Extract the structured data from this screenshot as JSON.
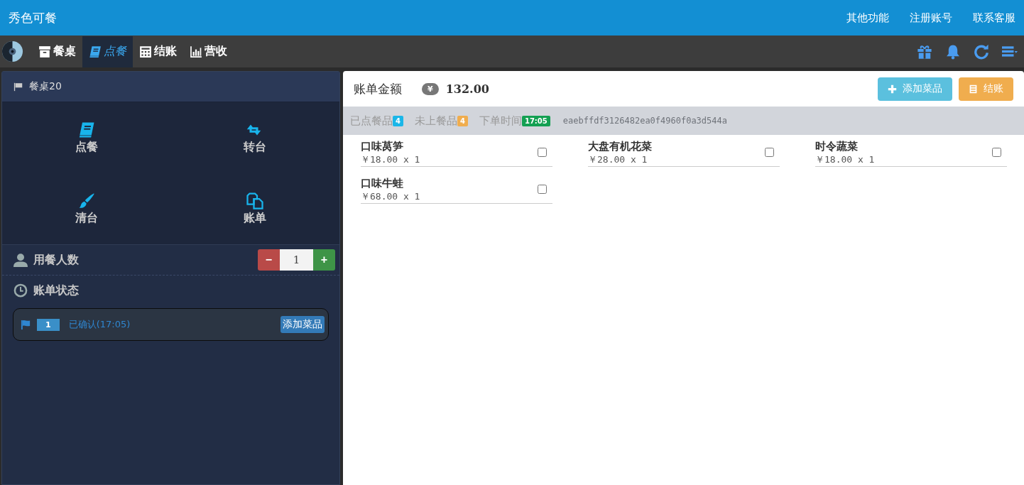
{
  "app_title": "秀色可餐",
  "top_links": [
    "其他功能",
    "注册账号",
    "联系客服"
  ],
  "nav_tabs": [
    {
      "label": "餐桌",
      "selected": false
    },
    {
      "label": "点餐",
      "selected": true
    },
    {
      "label": "结账",
      "selected": false
    },
    {
      "label": "营收",
      "selected": false
    }
  ],
  "table_panel": {
    "title": "餐桌20",
    "actions": [
      {
        "label": "点餐"
      },
      {
        "label": "转台"
      },
      {
        "label": "清台"
      },
      {
        "label": "账单"
      }
    ],
    "guests": {
      "label": "用餐人数",
      "value": "1",
      "minus": "−",
      "plus": "+"
    },
    "bill_status": {
      "label": "账单状态",
      "entries": [
        {
          "number": "1",
          "text": "已确认(17:05)",
          "button": "添加菜品"
        }
      ]
    }
  },
  "bill": {
    "label": "账单金额",
    "currency": "¥",
    "amount": "132.00",
    "buttons": [
      {
        "label": "添加菜品",
        "kind": "add",
        "color": "#5bc0de"
      },
      {
        "label": "结账",
        "kind": "checkout",
        "color": "#f0ad4e"
      }
    ],
    "info": [
      {
        "label": "已点餐品",
        "badge": "4",
        "color": "#1ab6e8"
      },
      {
        "label": "未上餐品",
        "badge": "4",
        "color": "#f0ad4e"
      },
      {
        "label": "下单时间",
        "badge": "17:05",
        "color": "#13a052"
      }
    ],
    "order_id": "eaebffdf3126482ea0f4960f0a3d544a",
    "dishes": [
      {
        "name": "口味莴笋",
        "price": "￥18.00 x 1",
        "checked": false
      },
      {
        "name": "大盘有机花菜",
        "price": "￥28.00 x 1",
        "checked": false
      },
      {
        "name": "时令蔬菜",
        "price": "￥18.00 x 1",
        "checked": false
      },
      {
        "name": "口味牛蛙",
        "price": "￥68.00 x 1",
        "checked": false
      }
    ]
  }
}
